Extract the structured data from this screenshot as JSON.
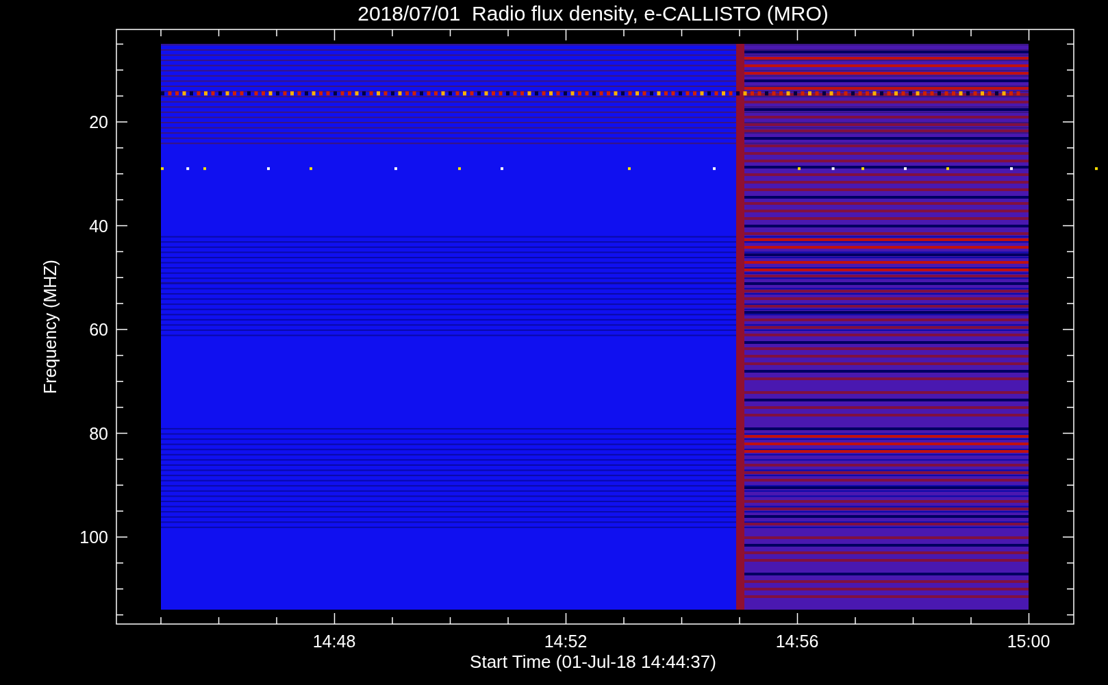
{
  "title": "2018/07/01  Radio flux density, e-CALLISTO (MRO)",
  "y_axis": {
    "label": "Frequency (MHZ)",
    "ticks": [
      "20",
      "40",
      "60",
      "80",
      "100"
    ]
  },
  "x_axis": {
    "label": "Start Time (01-Jul-18 14:44:37)",
    "ticks": [
      "14:48",
      "14:52",
      "14:56",
      "15:00"
    ]
  }
}
